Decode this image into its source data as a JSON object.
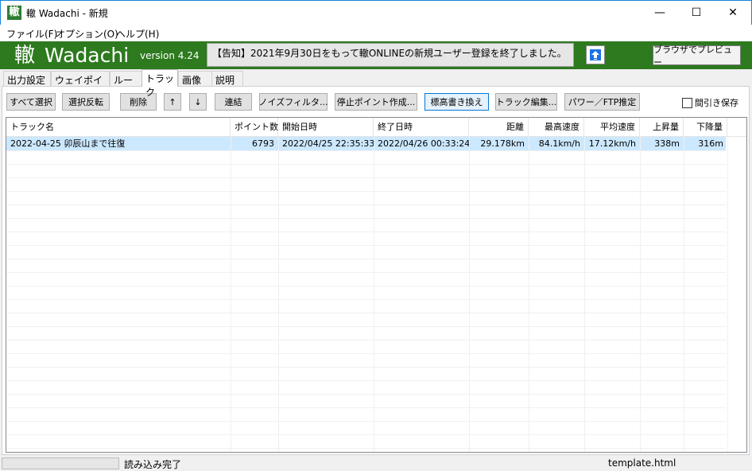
{
  "window": {
    "icon_glyph": "轍",
    "title": "轍 Wadachi - 新規",
    "minimize_glyph": "—",
    "maximize_glyph": "☐",
    "close_glyph": "✕"
  },
  "menu": {
    "items": [
      "ファイル(F)",
      "オプション(O)",
      "ヘルプ(H)"
    ]
  },
  "banner": {
    "kanji": "轍",
    "name": "Wadachi",
    "version": "version 4.24",
    "notice": "【告知】2021年9月30日をもって轍ONLINEの新規ユーザー登録を終了しました。",
    "preview_label": "ブラウザでプレビュー",
    "upload_icon": "upload-arrow-icon",
    "colors": {
      "background": "#2d7a1f",
      "accent": "#1a73e8"
    }
  },
  "tabs": {
    "items": [
      "出力設定",
      "ウェイポイント",
      "ルート",
      "トラック",
      "画像",
      "説明"
    ],
    "active": "トラック"
  },
  "toolbar": {
    "select_all": "すべて選択",
    "invert_selection": "選択反転",
    "delete": "削除",
    "move_up": "↑",
    "move_down": "↓",
    "join": "連結",
    "noise_filter": "ノイズフィルタ...",
    "create_stop_points": "停止ポイント作成...",
    "rewrite_elevation": "標高書き換え",
    "edit_track": "トラック編集...",
    "power_ftp": "パワー／FTP推定",
    "thinning_label": "間引き保存"
  },
  "table": {
    "headers": {
      "name": "トラック名",
      "points": "ポイント数",
      "start": "開始日時",
      "end": "終了日時",
      "distance": "距離",
      "max_speed": "最高速度",
      "avg_speed": "平均速度",
      "ascent": "上昇量",
      "descent": "下降量"
    },
    "rows": [
      {
        "name": "2022-04-25 卯辰山まで往復",
        "points": "6793",
        "start": "2022/04/25 22:35:33",
        "end": "2022/04/26 00:33:24",
        "distance": "29.178km",
        "max_speed": "84.1km/h",
        "avg_speed": "17.12km/h",
        "ascent": "338m",
        "descent": "316m"
      }
    ]
  },
  "status": {
    "message": "読み込み完了",
    "template": "template.html"
  }
}
